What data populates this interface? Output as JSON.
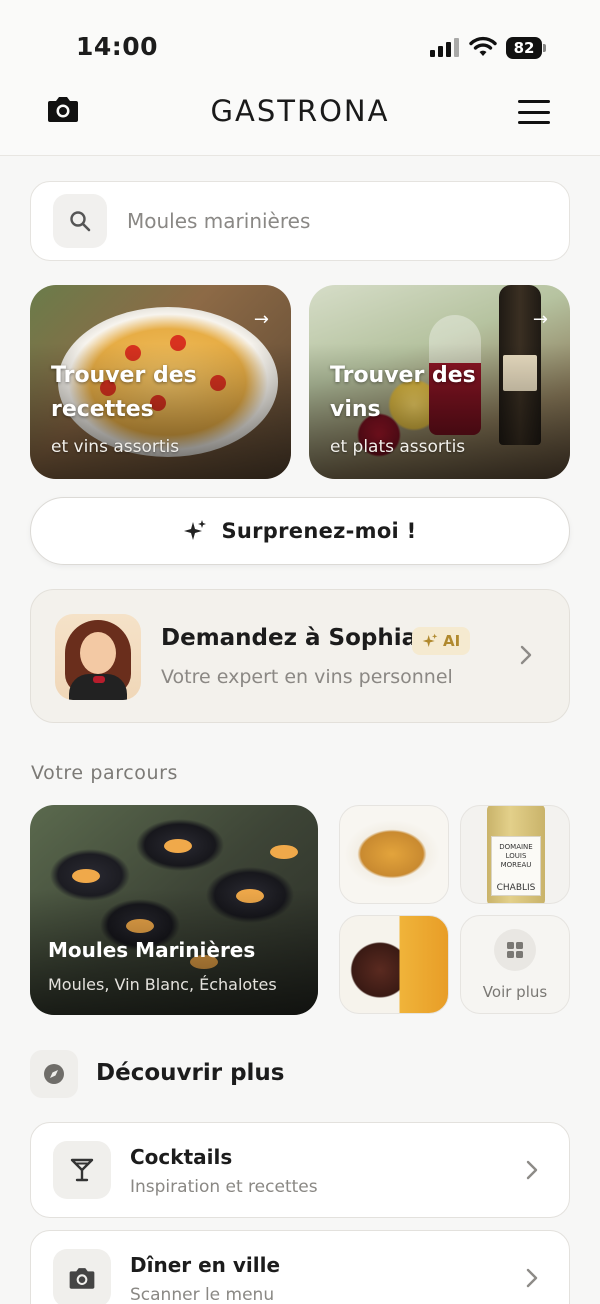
{
  "status_bar": {
    "time": "14:00",
    "battery": "82"
  },
  "header": {
    "brand": "GASTRONA"
  },
  "search": {
    "value": "Moules marinières"
  },
  "hero_cards": [
    {
      "title": "Trouver des recettes",
      "subtitle": "et vins assortis"
    },
    {
      "title": "Trouver des vins",
      "subtitle": "et plats assortis"
    }
  ],
  "surprise": {
    "label": "Surprenez-moi !"
  },
  "sophia": {
    "title": "Demandez à Sophia",
    "badge": "AI",
    "subtitle": "Votre expert en vins personnel"
  },
  "parcours": {
    "label": "Votre parcours",
    "featured": {
      "title": "Moules Marinières",
      "subtitle": "Moules, Vin Blanc, Échalotes"
    },
    "wine_label": {
      "line1": "DOMAINE",
      "line2": "LOUIS MOREAU",
      "line3": "CHABLIS"
    },
    "more_label": "Voir plus"
  },
  "discover": {
    "title": "Découvrir plus",
    "items": [
      {
        "title": "Cocktails",
        "subtitle": "Inspiration et recettes",
        "icon": "cocktail-icon"
      },
      {
        "title": "Dîner en ville",
        "subtitle": "Scanner le menu",
        "icon": "camera-icon"
      }
    ]
  },
  "colors": {
    "accent_gold": "#b0892e",
    "badge_bg": "#f5ead0",
    "text_dark": "#1c1c1c",
    "text_muted": "#8a8884"
  }
}
